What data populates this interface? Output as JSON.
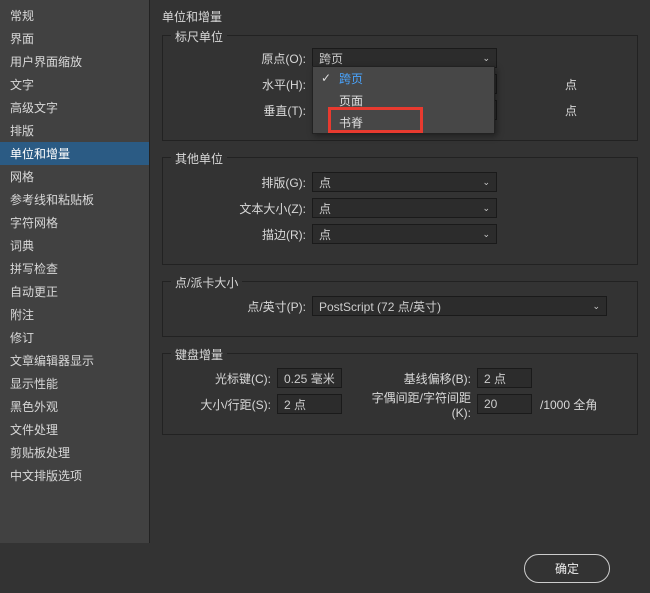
{
  "page_title": "单位和增量",
  "sidebar": {
    "items": [
      {
        "label": "常规"
      },
      {
        "label": "界面"
      },
      {
        "label": "用户界面缩放"
      },
      {
        "label": "文字"
      },
      {
        "label": "高级文字"
      },
      {
        "label": "排版"
      },
      {
        "label": "单位和增量",
        "selected": true
      },
      {
        "label": "网格"
      },
      {
        "label": "参考线和粘贴板"
      },
      {
        "label": "字符网格"
      },
      {
        "label": "词典"
      },
      {
        "label": "拼写检查"
      },
      {
        "label": "自动更正"
      },
      {
        "label": "附注"
      },
      {
        "label": "修订"
      },
      {
        "label": "文章编辑器显示"
      },
      {
        "label": "显示性能"
      },
      {
        "label": "黑色外观"
      },
      {
        "label": "文件处理"
      },
      {
        "label": "剪贴板处理"
      },
      {
        "label": "中文排版选项"
      }
    ]
  },
  "groups": {
    "ruler": {
      "title": "标尺单位",
      "origin_label": "原点(O):",
      "origin_value": "跨页",
      "horiz_label": "水平(H):",
      "horiz_value": "点",
      "horiz_unit": "点",
      "vert_label": "垂直(T):",
      "vert_value": "点",
      "vert_unit": "点",
      "dropdown_items": [
        "跨页",
        "页面",
        "书脊"
      ]
    },
    "other": {
      "title": "其他单位",
      "typeset_label": "排版(G):",
      "typeset_value": "点",
      "textsize_label": "文本大小(Z):",
      "textsize_value": "点",
      "stroke_label": "描边(R):",
      "stroke_value": "点"
    },
    "point": {
      "title": "点/派卡大小",
      "ppi_label": "点/英寸(P):",
      "ppi_value": "PostScript  (72 点/英寸)"
    },
    "keyboard": {
      "title": "键盘增量",
      "cursor_label": "光标键(C):",
      "cursor_value": "0.25 毫米",
      "leading_label": "大小/行距(S):",
      "leading_value": "2 点",
      "baseline_label": "基线偏移(B):",
      "baseline_value": "2 点",
      "kerning_label": "字偶间距/字符间距 (K):",
      "kerning_value": "20",
      "kerning_unit": "/1000 全角"
    }
  },
  "buttons": {
    "ok": "确定"
  }
}
